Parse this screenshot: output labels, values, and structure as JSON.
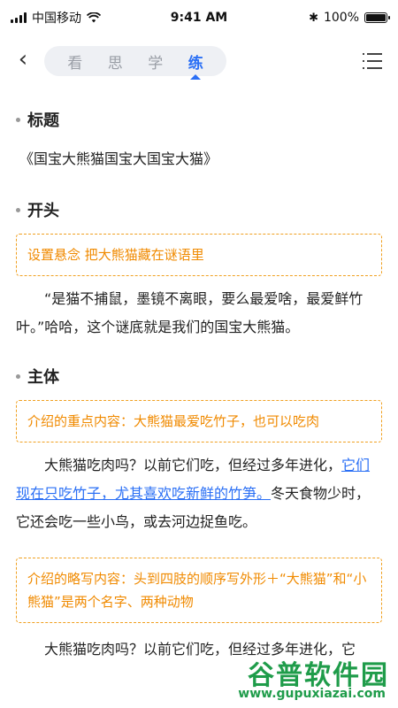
{
  "status": {
    "carrier": "中国移动",
    "time": "9:41 AM",
    "battery": "100%"
  },
  "nav": {
    "tabs": [
      {
        "label": "看"
      },
      {
        "label": "思"
      },
      {
        "label": "学"
      },
      {
        "label": "练"
      }
    ],
    "active_tab": "练"
  },
  "sections": {
    "title_section": {
      "heading": "标题",
      "text": "《国宝大熊猫国宝大国宝大猫》"
    },
    "opening": {
      "heading": "开头",
      "note": "设置悬念 把大熊猫藏在谜语里",
      "para": "“是猫不捕鼠，墨镜不离眼，要么最爱啥，最爱鲜竹叶。”哈哈，这个谜底就是我们的国宝大熊猫。"
    },
    "body": {
      "heading": "主体",
      "note1": "介绍的重点内容：大熊猫最爱吃竹子，也可以吃肉",
      "para1_a": "大熊猫吃肉吗？以前它们吃，但经过多年进化，",
      "para1_link": "它们现在只吃竹子，尤其喜欢吃新鲜的竹笋。",
      "para1_b": "冬天食物少时，它还会吃一些小鸟，或去河边捉鱼吃。",
      "note2": "介绍的略写内容：头到四肢的顺序写外形＋“大熊猫”和“小熊猫”是两个名字、两种动物",
      "para2": "大熊猫吃肉吗？以前它们吃，但经过多年进化，它"
    }
  },
  "watermark": {
    "title": "谷普软件园",
    "url": "www.gupuxiazai.com"
  },
  "colors": {
    "accent": "#2a6ff5",
    "note": "#f08a00",
    "watermark": "#1f9c4a"
  }
}
